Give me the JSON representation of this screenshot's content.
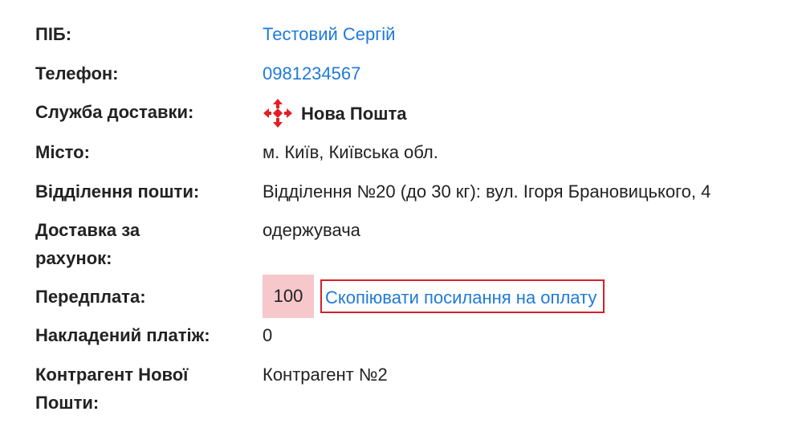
{
  "rows": {
    "name": {
      "label": "ПІБ:",
      "value": "Тестовий Сергій"
    },
    "phone": {
      "label": "Телефон:",
      "value": "0981234567"
    },
    "delivery_service": {
      "label": "Служба доставки:",
      "value": "Нова Пошта",
      "icon": "nova-poshta-logo-icon"
    },
    "city": {
      "label": "Місто:",
      "value": "м. Київ, Київська обл."
    },
    "branch": {
      "label": "Відділення пошти:",
      "value": "Відділення №20 (до 30 кг): вул. Ігоря Брановицького, 4"
    },
    "delivery_paid_by": {
      "label_line1": "Доставка за",
      "label_line2": "рахунок:",
      "value": "одержувача"
    },
    "prepayment": {
      "label": "Передплата:",
      "value": "100",
      "copy_link": "Скопіювати посилання на оплату"
    },
    "cod": {
      "label": "Накладений платіж:",
      "value": "0"
    },
    "counterparty": {
      "label_line1": "Контрагент Нової",
      "label_line2": "Пошти:",
      "value": "Контрагент №2"
    }
  },
  "colors": {
    "link": "#1f7ad9",
    "brand_red": "#e31e24",
    "prepay_bg": "#f6c7cb",
    "copy_border": "#d4202a"
  }
}
